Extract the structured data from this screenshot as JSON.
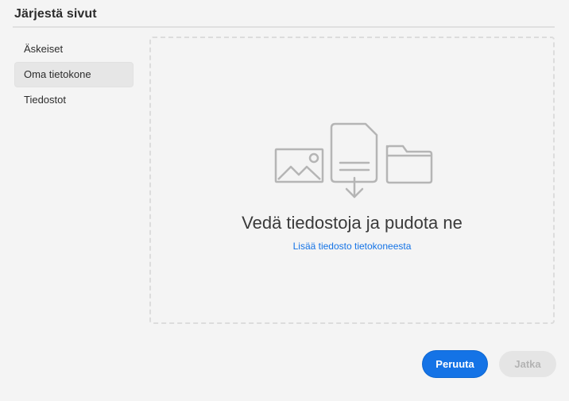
{
  "dialog": {
    "title": "Järjestä sivut"
  },
  "sidebar": {
    "items": [
      {
        "label": "Äskeiset",
        "selected": false
      },
      {
        "label": "Oma tietokone",
        "selected": true
      },
      {
        "label": "Tiedostot",
        "selected": false
      }
    ]
  },
  "dropzone": {
    "heading": "Vedä tiedostoja ja pudota ne",
    "link": "Lisää tiedosto tietokoneesta",
    "icons": [
      "image-icon",
      "document-download-icon",
      "folder-icon"
    ]
  },
  "footer": {
    "cancel_label": "Peruuta",
    "continue_label": "Jatka",
    "continue_disabled": true
  },
  "colors": {
    "accent": "#1473e6",
    "background": "#f4f4f4",
    "icon_stroke": "#b5b5b5"
  }
}
